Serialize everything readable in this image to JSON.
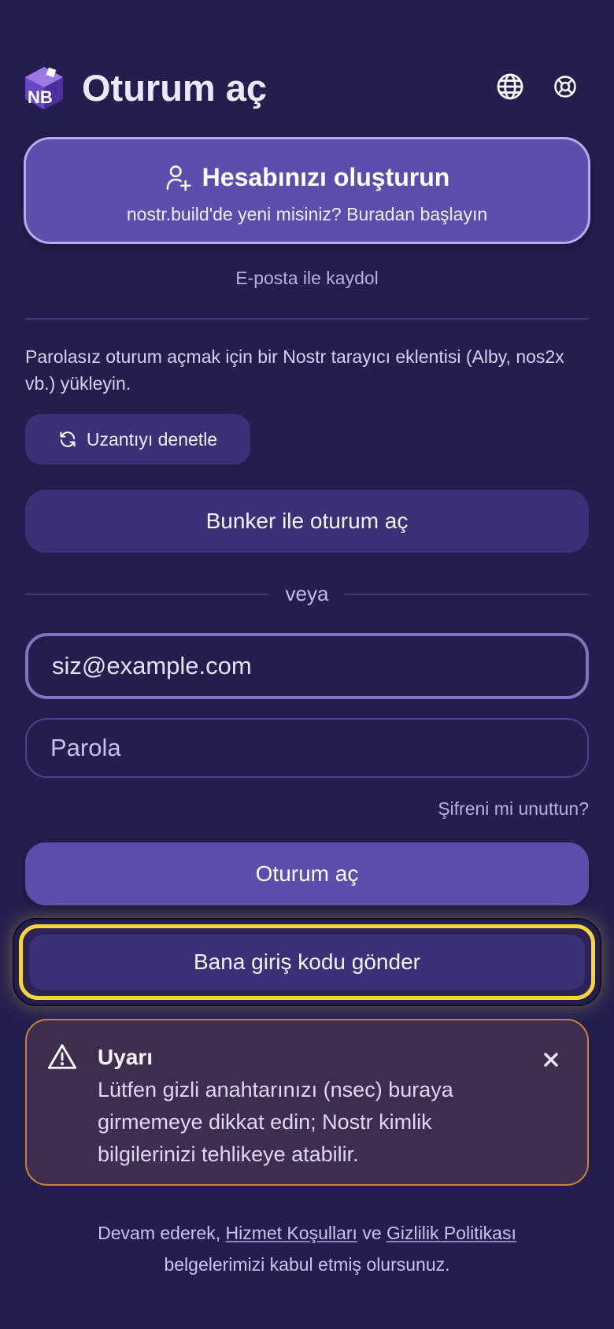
{
  "header": {
    "title": "Oturum aç",
    "logo_text": "NB",
    "icons": [
      "globe-icon",
      "lifebuoy-icon"
    ]
  },
  "create_account": {
    "title": "Hesabınızı oluşturun",
    "subtitle": "nostr.build'de yeni misiniz? Buradan başlayın",
    "icon": "user-plus-icon"
  },
  "email_signup_label": "E-posta ile kaydol",
  "nostr": {
    "description": "Parolasız oturum açmak için bir Nostr tarayıcı eklentisi (Alby, nos2x vb.) yükleyin.",
    "check_extension_label": "Uzantıyı denetle",
    "check_icon": "refresh-icon",
    "bunker_label": "Bunker ile oturum aç"
  },
  "or_label": "veya",
  "form": {
    "email_value": "siz@example.com",
    "password_placeholder": "Parola",
    "forgot_label": "Şifreni mi unuttun?",
    "signin_label": "Oturum aç",
    "send_code_label": "Bana giriş kodu gönder"
  },
  "warning": {
    "title": "Uyarı",
    "body": "Lütfen gizli anahtarınızı (nsec) buraya girmemeye dikkat edin; Nostr kimlik bilgilerinizi tehlikeye atabilir.",
    "icon": "warning-triangle-icon"
  },
  "legal": {
    "prefix": "Devam ederek,",
    "terms_label": "Hizmet Koşulları",
    "conjunction": "ve",
    "privacy_label": "Gizlilik Politikası",
    "suffix": "belgelerimizi kabul etmiş olursunuz."
  },
  "colors": {
    "background": "#241e4e",
    "primary": "#5b4fae",
    "secondary_button": "#3a3078",
    "highlight": "#f9d43a",
    "warning_border": "#c9823a"
  }
}
